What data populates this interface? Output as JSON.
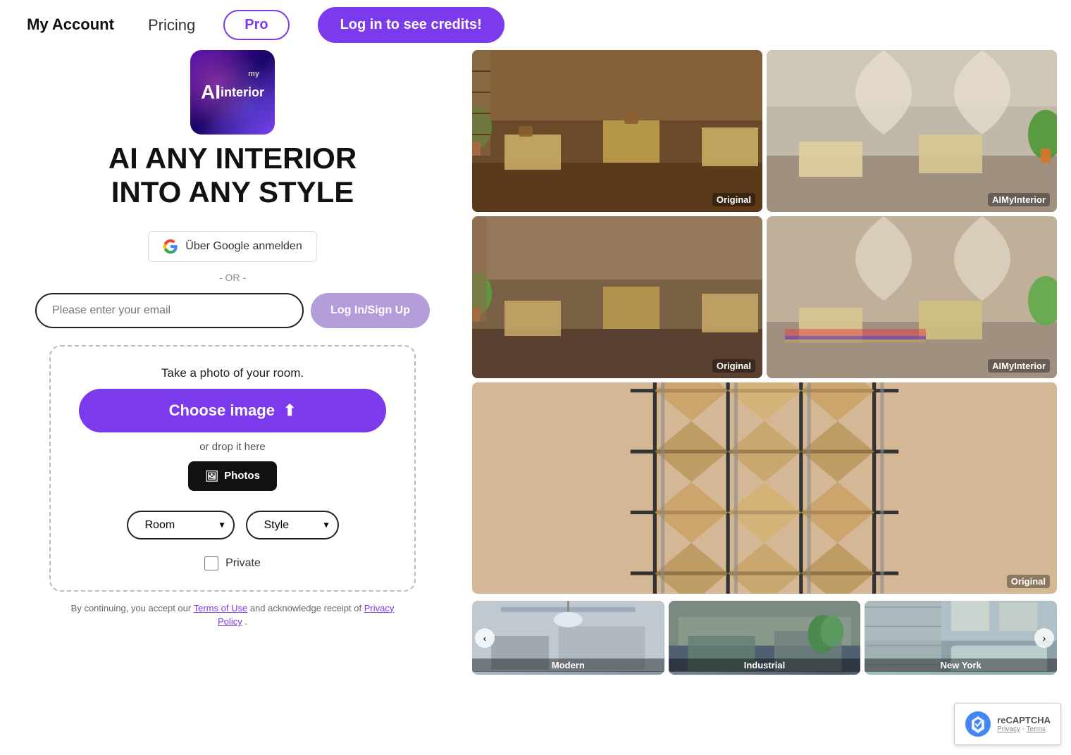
{
  "header": {
    "my_account_label": "My Account",
    "pricing_label": "Pricing",
    "pro_label": "Pro",
    "login_label": "Log in to see credits!"
  },
  "hero": {
    "headline_line1": "AI ANY INTERIOR",
    "headline_line2": "INTO ANY STYLE",
    "logo_ai": "AI",
    "logo_word": "interior",
    "logo_my": "my"
  },
  "auth": {
    "google_label": "Über Google anmelden",
    "or_text": "- OR -",
    "email_placeholder": "Please enter your email",
    "login_signup_label": "Log In/Sign Up"
  },
  "upload": {
    "title": "Take a photo of your room.",
    "choose_label": "Choose image",
    "drop_label": "or drop it here",
    "photos_label": "Photos",
    "room_label": "Room",
    "style_label": "Style",
    "private_label": "Private",
    "terms_text": "By continuing, you accept our ",
    "terms_link": "Terms of Use",
    "and_text": " and acknowledge receipt of ",
    "privacy_link": "Privacy Policy",
    "period": "."
  },
  "gallery": {
    "top_row": [
      {
        "label": "Original"
      },
      {
        "label": "AIMyInterior"
      }
    ],
    "middle_row": [
      {
        "label": "Original"
      },
      {
        "label": "AIMyInterior"
      }
    ],
    "single": {
      "label": "Original"
    },
    "thumbnails": [
      {
        "label": "Modern"
      },
      {
        "label": "Industrial"
      },
      {
        "label": "New York"
      }
    ]
  },
  "recaptcha": {
    "main_text": "Privacy - Terms",
    "protected_by": "reCAPTCHA"
  },
  "colors": {
    "purple": "#7c3aed",
    "purple_light": "#b39ddb",
    "dark": "#111111",
    "white": "#ffffff"
  }
}
